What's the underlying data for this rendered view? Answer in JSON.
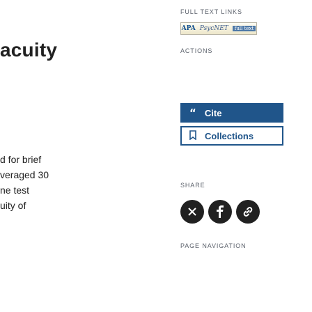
{
  "article": {
    "heading": "acuity",
    "lines": [
      "d for brief",
      "veraged 30",
      "ne test",
      "uity of"
    ]
  },
  "sidebar": {
    "full_text_links": {
      "label": "FULL TEXT LINKS",
      "logo_alt": "APA full text"
    },
    "actions": {
      "label": "ACTIONS",
      "cite_label": "Cite",
      "cite_icon": "quote-icon",
      "collections_label": "Collections",
      "collections_icon": "bookmark-icon"
    },
    "share": {
      "label": "SHARE",
      "items": [
        "twitter-x-icon",
        "facebook-icon",
        "permalink-icon"
      ]
    },
    "page_navigation": {
      "label": "PAGE NAVIGATION"
    }
  },
  "colors": {
    "accent": "#20558a",
    "text": "#212121",
    "muted": "#5b616b"
  }
}
